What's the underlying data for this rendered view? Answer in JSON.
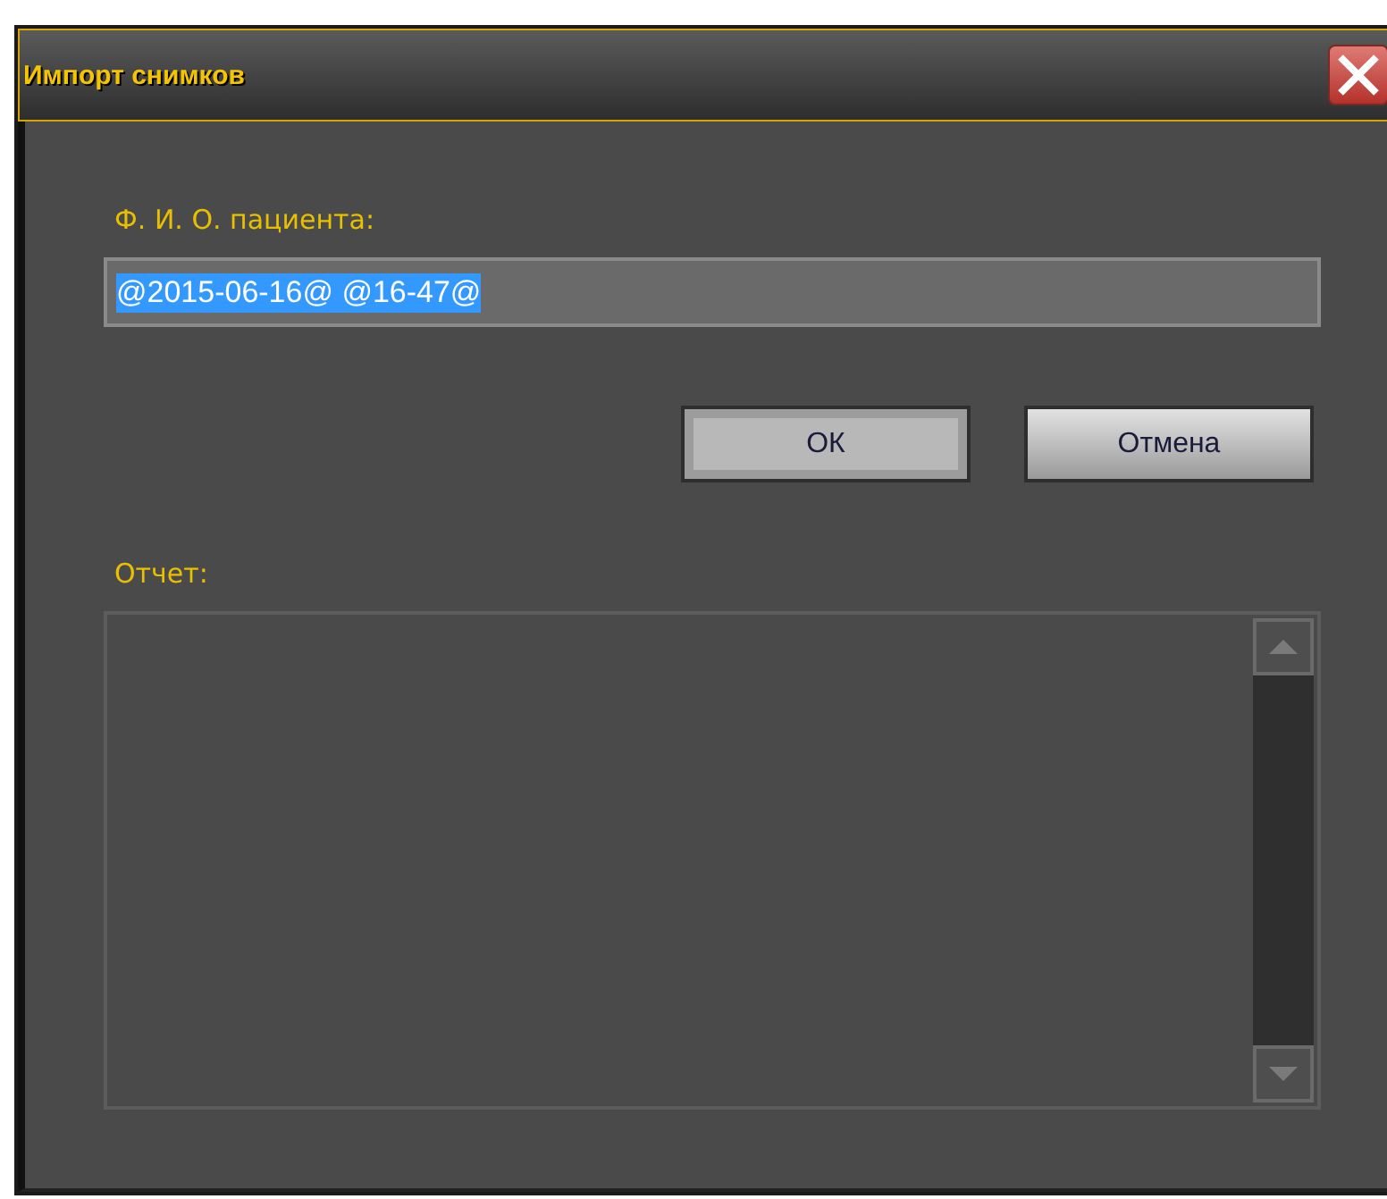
{
  "window": {
    "title": "Импорт снимков"
  },
  "patient_field": {
    "label": "Ф. И. О. пациента:",
    "value": "@2015-06-16@ @16-47@",
    "value_selected": true
  },
  "buttons": [
    {
      "label": "ОК",
      "focused": true
    },
    {
      "label": "Отмена",
      "focused": false
    }
  ],
  "report": {
    "label": "Отчет:"
  }
}
